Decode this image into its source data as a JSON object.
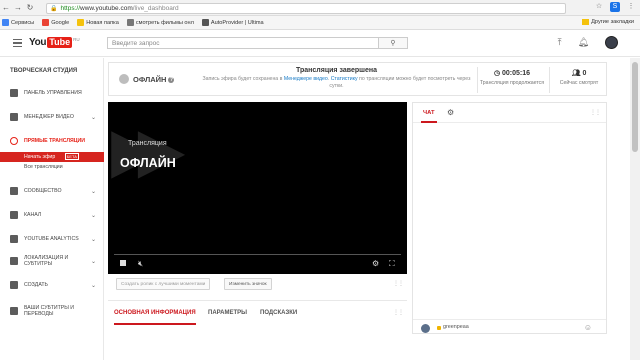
{
  "browser": {
    "url_https": "https://",
    "url_host": "www.youtube.com",
    "url_path": "/live_dashboard",
    "bookmarks": [
      {
        "label": "Сервисы",
        "color": "#4285f4"
      },
      {
        "label": "Google",
        "color": "#ea4335"
      },
      {
        "label": "Новая папка",
        "color": "#f4c20d"
      },
      {
        "label": "смотреть фильмы онл",
        "color": "#777777"
      },
      {
        "label": "AutoProvider | Ultima",
        "color": "#555555"
      }
    ],
    "other_bookmarks": "Другие закладки"
  },
  "header": {
    "logo_you": "You",
    "logo_tube": "Tube",
    "logo_region": "RU",
    "search_placeholder": "Введите запрос"
  },
  "sidebar": {
    "title": "ТВОРЧЕСКАЯ СТУДИЯ",
    "items": [
      {
        "label": "ПАНЕЛЬ УПРАВЛЕНИЯ",
        "has_chevron": false
      },
      {
        "label": "МЕНЕДЖЕР ВИДЕО",
        "has_chevron": true
      },
      {
        "label": "ПРЯМЫЕ ТРАНСЛЯЦИИ",
        "has_chevron": false
      },
      {
        "label": "СООБЩЕСТВО",
        "has_chevron": true
      },
      {
        "label": "КАНАЛ",
        "has_chevron": true
      },
      {
        "label": "YOUTUBE ANALYTICS",
        "has_chevron": true
      },
      {
        "label": "ЛОКАЛИЗАЦИЯ И СУБТИТРЫ",
        "has_chevron": true
      },
      {
        "label": "СОЗДАТЬ",
        "has_chevron": true
      },
      {
        "label": "ВАШИ СУБТИТРЫ И ПЕРЕВОДЫ",
        "has_chevron": false
      }
    ],
    "sub_active": "Начать эфир",
    "sub_active_badge": "БЕТА",
    "sub_item": "Все трансляции"
  },
  "status": {
    "offline_label": "ОФЛАЙН",
    "title": "Трансляция завершена",
    "desc_pre": "Запись эфира будет сохранена в ",
    "desc_link1": "Менеджере видео",
    "desc_mid": ". ",
    "desc_link2": "Статистику",
    "desc_post": " по трансляции можно будет посмотреть через сутки.",
    "duration": "00:05:16",
    "duration_label": "Трансляция продолжается",
    "viewers": "0",
    "viewers_label": "Сейчас смотрят"
  },
  "player": {
    "label": "Трансляция",
    "state": "ОФЛАЙН"
  },
  "actions": {
    "best_moments": "Создать ролик с лучшими моментами",
    "change_thumb": "Изменить значок"
  },
  "tabs": [
    "ОСНОВНАЯ ИНФОРМАЦИЯ",
    "ПАРАМЕТРЫ",
    "ПОДСКАЗКИ"
  ],
  "chat": {
    "tab_label": "ЧАТ",
    "username": "greenpeaa"
  }
}
